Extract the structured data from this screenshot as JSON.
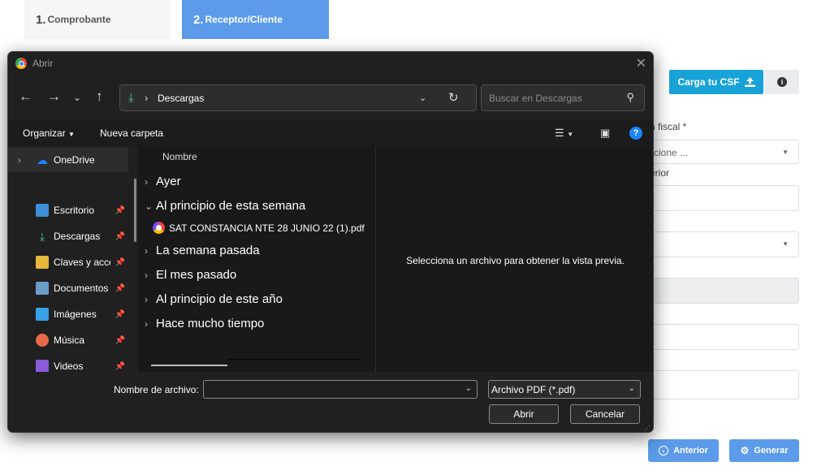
{
  "steps": [
    {
      "num": "1.",
      "label": "Comprobante"
    },
    {
      "num": "2.",
      "label": "Receptor/Cliente"
    }
  ],
  "background": {
    "csf_button": "Carga tu CSF",
    "info_icon": "i",
    "label_regimen": "n fiscal *",
    "select_placeholder": "cione ...",
    "label_anterior": "erior",
    "prev_button": "Anterior",
    "next_button": "Generar"
  },
  "dialog": {
    "title": "Abrir",
    "address_path": "Descargas",
    "search_placeholder": "Buscar en Descargas",
    "organize": "Organizar",
    "new_folder": "Nueva carpeta",
    "help": "?",
    "sidebar": [
      {
        "label": "OneDrive",
        "icon": "cloud-icon"
      },
      {
        "label": "Escritorio",
        "icon": "desktop-icon"
      },
      {
        "label": "Descargas",
        "icon": "download-icon"
      },
      {
        "label": "Claves y acce",
        "icon": "folder-icon"
      },
      {
        "label": "Documentos",
        "icon": "documents-icon"
      },
      {
        "label": "Imágenes",
        "icon": "pictures-icon"
      },
      {
        "label": "Música",
        "icon": "music-icon"
      },
      {
        "label": "Videos",
        "icon": "videos-icon"
      }
    ],
    "column_header": "Nombre",
    "groups": [
      {
        "label": "Ayer",
        "expanded": false
      },
      {
        "label": "Al principio de esta semana",
        "expanded": true
      },
      {
        "label": "La semana pasada",
        "expanded": false
      },
      {
        "label": "El mes pasado",
        "expanded": false
      },
      {
        "label": "Al principio de este año",
        "expanded": false
      },
      {
        "label": "Hace mucho tiempo",
        "expanded": false
      }
    ],
    "file": "SAT CONSTANCIA NTE 28 JUNIO 22 (1).pdf",
    "preview_text": "Selecciona un archivo para obtener la vista previa.",
    "filename_label": "Nombre de archivo:",
    "filename_value": "",
    "file_type": "Archivo PDF (*.pdf)",
    "open_button": "Abrir",
    "cancel_button": "Cancelar"
  }
}
